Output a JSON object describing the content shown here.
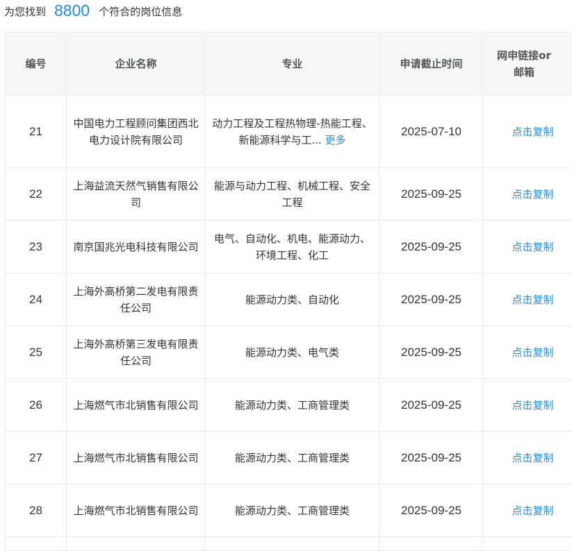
{
  "summary": {
    "prefix": "为您找到",
    "count": "8800",
    "suffix": "个符合的岗位信息"
  },
  "table": {
    "headers": {
      "num": "编号",
      "company": "企业名称",
      "major": "专业",
      "deadline": "申请截止时间",
      "link": "网申链接or邮箱"
    },
    "rows": [
      {
        "num": "21",
        "company": "中国电力工程顾问集团西北电力设计院有限公司",
        "major": "动力工程及工程热物理-热能工程、新能源科学与工...",
        "more": "更多",
        "deadline": "2025-07-10",
        "link": "点击复制"
      },
      {
        "num": "22",
        "company": "上海益流天然气销售有限公司",
        "major": "能源与动力工程、机械工程、安全工程",
        "more": "",
        "deadline": "2025-09-25",
        "link": "点击复制"
      },
      {
        "num": "23",
        "company": "南京国兆光电科技有限公司",
        "major": "电气、自动化、机电、能源动力、环境工程、化工",
        "more": "",
        "deadline": "2025-09-25",
        "link": "点击复制"
      },
      {
        "num": "24",
        "company": "上海外高桥第二发电有限责任公司",
        "major": "能源动力类、自动化",
        "more": "",
        "deadline": "2025-09-25",
        "link": "点击复制"
      },
      {
        "num": "25",
        "company": "上海外高桥第三发电有限责任公司",
        "major": "能源动力类、电气类",
        "more": "",
        "deadline": "2025-09-25",
        "link": "点击复制"
      },
      {
        "num": "26",
        "company": "上海燃气市北销售有限公司",
        "major": "能源动力类、工商管理类",
        "more": "",
        "deadline": "2025-09-25",
        "link": "点击复制"
      },
      {
        "num": "27",
        "company": "上海燃气市北销售有限公司",
        "major": "能源动力类、工商管理类",
        "more": "",
        "deadline": "2025-09-25",
        "link": "点击复制"
      },
      {
        "num": "28",
        "company": "上海燃气市北销售有限公司",
        "major": "能源动力类、工商管理类",
        "more": "",
        "deadline": "2025-09-25",
        "link": "点击复制"
      }
    ]
  }
}
